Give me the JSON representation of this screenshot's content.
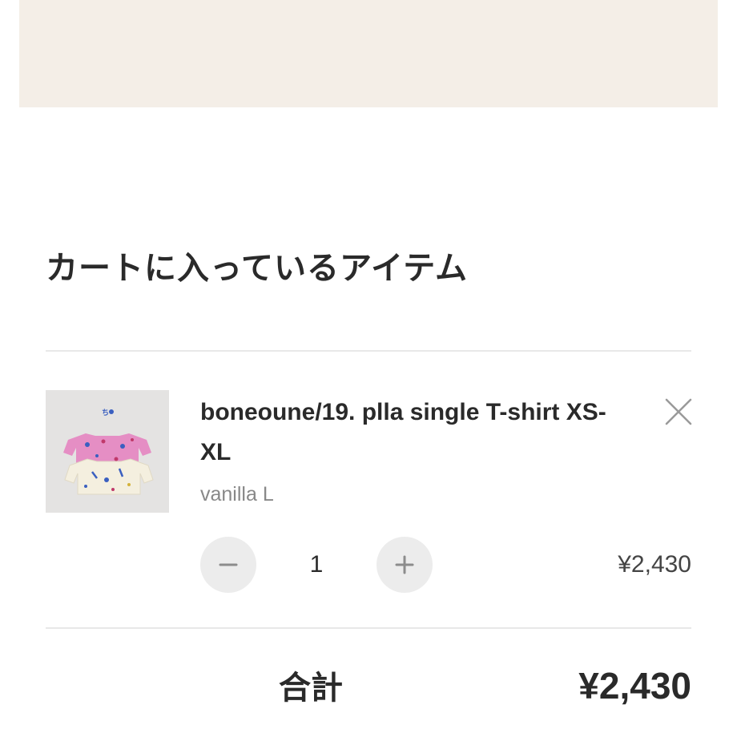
{
  "cart": {
    "title": "カートに入っているアイテム",
    "item": {
      "name": "boneoune/19. plla single T-shirt XS-XL",
      "variant": "vanilla L",
      "quantity": "1",
      "price": "¥2,430"
    },
    "total_label": "合計",
    "total_value": "¥2,430"
  },
  "colors": {
    "banner": "#f4eee7",
    "stepper_bg": "#ececec",
    "text": "#2a2a2a",
    "muted": "#888888"
  },
  "icons": {
    "remove": "close-icon",
    "decrease": "minus-icon",
    "increase": "plus-icon"
  }
}
